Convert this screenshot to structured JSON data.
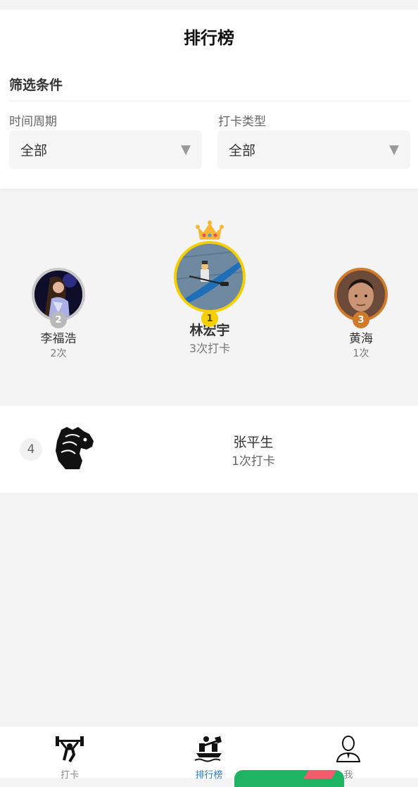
{
  "header": {
    "title": "排行榜"
  },
  "filters": {
    "title": "筛选条件",
    "period": {
      "label": "时间周期",
      "value": "全部"
    },
    "type": {
      "label": "打卡类型",
      "value": "全部"
    }
  },
  "podium": {
    "first": {
      "rank": "1",
      "name": "林宏宇",
      "count": "3次打卡"
    },
    "second": {
      "rank": "2",
      "name": "李福浩",
      "count": "2次"
    },
    "third": {
      "rank": "3",
      "name": "黄海",
      "count": "1次"
    }
  },
  "list": [
    {
      "rank": "4",
      "name": "张平生",
      "count": "1次打卡"
    }
  ],
  "tabs": [
    {
      "label": "打卡",
      "icon": "weightlifting-icon"
    },
    {
      "label": "排行榜",
      "icon": "kayak-icon"
    },
    {
      "label": "我",
      "icon": "user-icon"
    }
  ],
  "colors": {
    "accent": "#1e7fd4",
    "gold": "#f5cf00",
    "silver": "#b9b9b9",
    "bronze": "#d07a2b"
  }
}
